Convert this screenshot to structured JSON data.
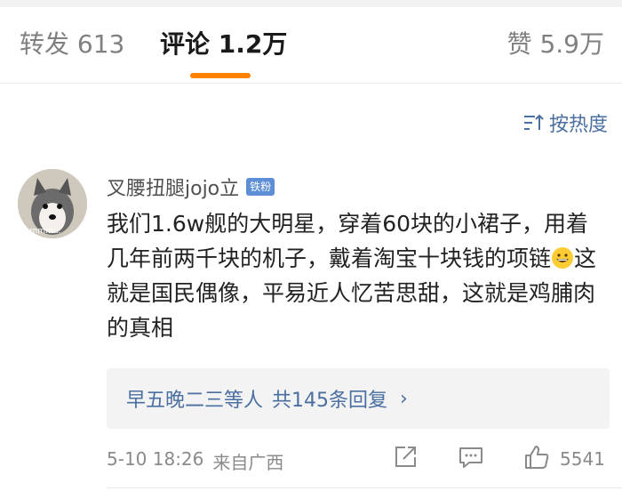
{
  "tabs": {
    "repost": "转发 613",
    "comments": "评论 1.2万",
    "likes": "赞 5.9万"
  },
  "sort": {
    "label": "按热度",
    "icon": "sort-icon"
  },
  "comment": {
    "username": "叉腰扭腿jojo立",
    "badge": "铁粉",
    "avatar_text": "emmm...",
    "text_part1": "我们1.6w舰的大明星，穿着60块的小裙子，用着几年前两千块的机子，戴着淘宝十块钱的项链",
    "text_part2": "这就是国民偶像，平易近人忆苦思甜，这就是鸡脯肉的真相",
    "emoji": "grinning-face-icon",
    "replies": {
      "names": "早五晚二三等人",
      "count": "共145条回复"
    },
    "date": "5-10 18:26",
    "location": "来自广西",
    "like_count": "5541"
  },
  "colors": {
    "accent": "#ff8200",
    "link": "#4a6fa0",
    "badge": "#5c8fd6"
  }
}
